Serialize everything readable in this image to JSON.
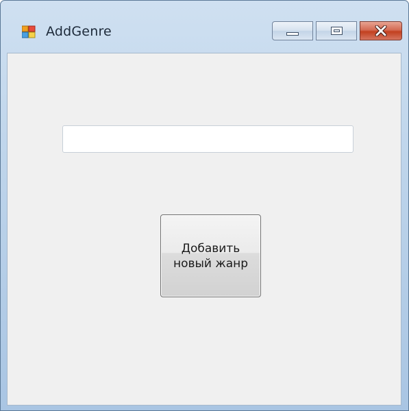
{
  "window": {
    "title": "AddGenre",
    "icon": "winforms-app-icon"
  },
  "title_buttons": {
    "minimize": "minimize-icon",
    "maximize": "maximize-icon",
    "close": "close-icon"
  },
  "form": {
    "genre_input_value": "",
    "add_button_label": "Добавить новый жанр"
  },
  "colors": {
    "client_background": "#f0f0f0",
    "close_button": "#c2401f"
  }
}
